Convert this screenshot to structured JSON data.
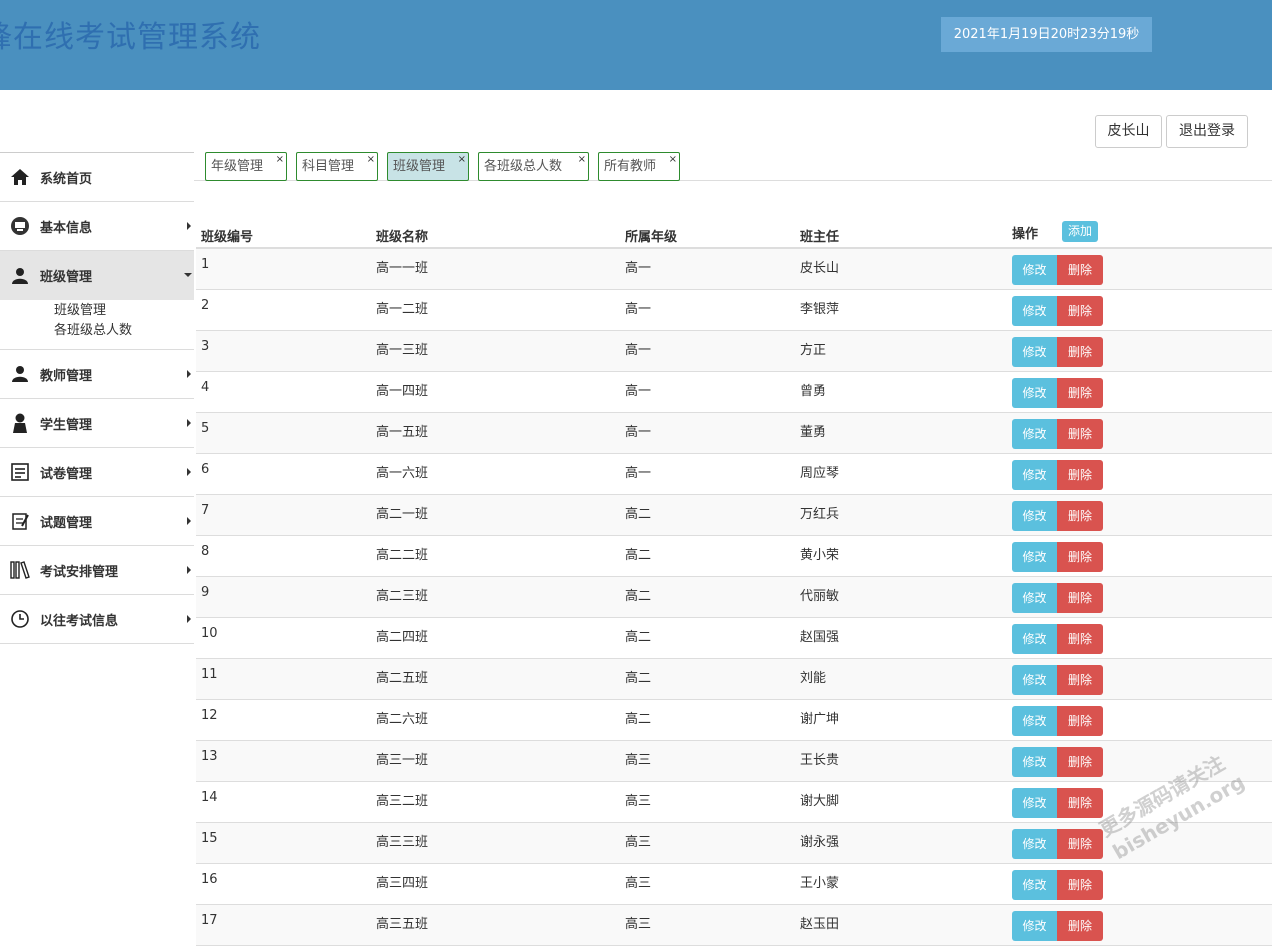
{
  "header": {
    "title": "锋在线考试管理系统",
    "clock": "2021年1月19日20时23分19秒"
  },
  "user": {
    "name": "皮长山",
    "logout": "退出登录"
  },
  "sidebar": {
    "items": [
      {
        "label": "系统首页",
        "icon": "home-icon"
      },
      {
        "label": "基本信息",
        "icon": "info-icon"
      },
      {
        "label": "班级管理",
        "icon": "class-icon",
        "expanded": true,
        "children": [
          "班级管理",
          "各班级总人数"
        ]
      },
      {
        "label": "教师管理",
        "icon": "teacher-icon"
      },
      {
        "label": "学生管理",
        "icon": "student-icon"
      },
      {
        "label": "试卷管理",
        "icon": "paper-icon"
      },
      {
        "label": "试题管理",
        "icon": "question-icon"
      },
      {
        "label": "考试安排管理",
        "icon": "books-icon"
      },
      {
        "label": "以往考试信息",
        "icon": "clock-icon"
      }
    ]
  },
  "tabs": [
    {
      "label": "年级管理",
      "active": false
    },
    {
      "label": "科目管理",
      "active": false
    },
    {
      "label": "班级管理",
      "active": true
    },
    {
      "label": "各班级总人数",
      "active": false
    },
    {
      "label": "所有教师",
      "active": false
    }
  ],
  "tab_close": "×",
  "table": {
    "columns": [
      "班级编号",
      "班级名称",
      "所属年级",
      "班主任",
      "操作"
    ],
    "add_label": "添加",
    "edit_label": "修改",
    "delete_label": "删除",
    "rows": [
      [
        "1",
        "高一一班",
        "高一",
        "皮长山"
      ],
      [
        "2",
        "高一二班",
        "高一",
        "李银萍"
      ],
      [
        "3",
        "高一三班",
        "高一",
        "方正"
      ],
      [
        "4",
        "高一四班",
        "高一",
        "曾勇"
      ],
      [
        "5",
        "高一五班",
        "高一",
        "董勇"
      ],
      [
        "6",
        "高一六班",
        "高一",
        "周应琴"
      ],
      [
        "7",
        "高二一班",
        "高二",
        "万红兵"
      ],
      [
        "8",
        "高二二班",
        "高二",
        "黄小荣"
      ],
      [
        "9",
        "高二三班",
        "高二",
        "代丽敏"
      ],
      [
        "10",
        "高二四班",
        "高二",
        "赵国强"
      ],
      [
        "11",
        "高二五班",
        "高二",
        "刘能"
      ],
      [
        "12",
        "高二六班",
        "高二",
        "谢广坤"
      ],
      [
        "13",
        "高三一班",
        "高三",
        "王长贵"
      ],
      [
        "14",
        "高三二班",
        "高三",
        "谢大脚"
      ],
      [
        "15",
        "高三三班",
        "高三",
        "谢永强"
      ],
      [
        "16",
        "高三四班",
        "高三",
        "王小蒙"
      ],
      [
        "17",
        "高三五班",
        "高三",
        "赵玉田"
      ]
    ]
  },
  "watermark": {
    "line1": "更多源码请关注",
    "line2": "bisheyun.org"
  },
  "colors": {
    "header_bg": "#4a90bf",
    "info_button": "#5bc0de",
    "danger_button": "#d9534f",
    "tab_border": "#2e8b2e"
  }
}
